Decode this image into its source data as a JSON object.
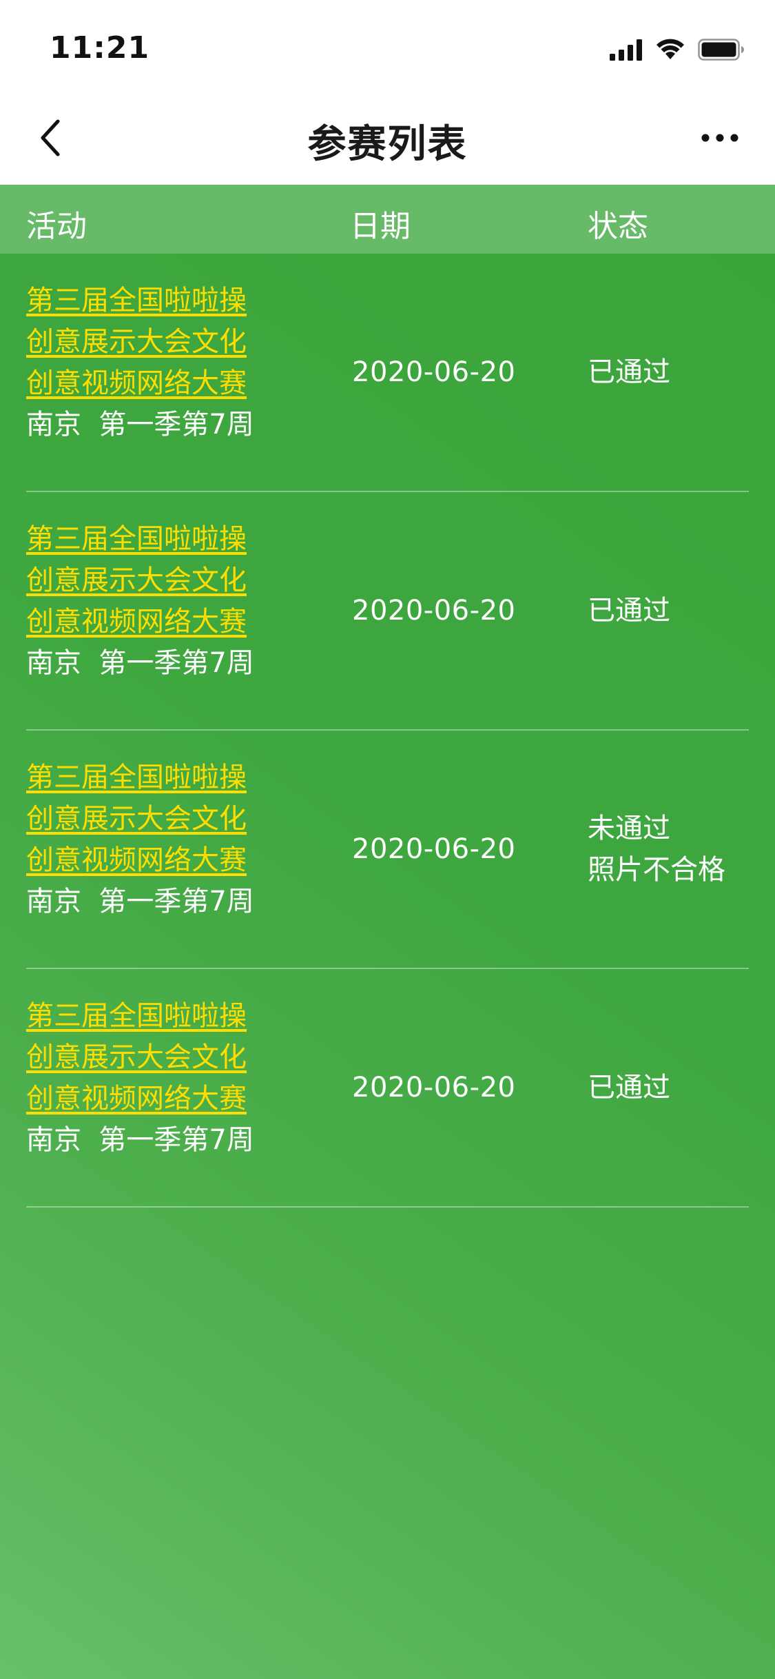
{
  "status_bar": {
    "time": "11:21",
    "icons": [
      "signal-icon",
      "wifi-icon",
      "battery-icon"
    ]
  },
  "nav": {
    "title": "参赛列表",
    "back_icon": "chevron-left-icon",
    "more_icon": "more-icon"
  },
  "table": {
    "headers": {
      "activity": "活动",
      "date": "日期",
      "status": "状态"
    },
    "rows": [
      {
        "activity_title": "第三届全国啦啦操\n创意展示大会文化\n创意视频网络大赛",
        "activity_meta": "南京  第一季第7周",
        "date": "2020-06-20",
        "status": "已通过",
        "status_reason": ""
      },
      {
        "activity_title": "第三届全国啦啦操\n创意展示大会文化\n创意视频网络大赛",
        "activity_meta": "南京  第一季第7周",
        "date": "2020-06-20",
        "status": "已通过",
        "status_reason": ""
      },
      {
        "activity_title": "第三届全国啦啦操\n创意展示大会文化\n创意视频网络大赛",
        "activity_meta": "南京  第一季第7周",
        "date": "2020-06-20",
        "status": "未通过",
        "status_reason": "照片不合格"
      },
      {
        "activity_title": "第三届全国啦啦操\n创意展示大会文化\n创意视频网络大赛",
        "activity_meta": "南京  第一季第7周",
        "date": "2020-06-20",
        "status": "已通过",
        "status_reason": ""
      }
    ]
  },
  "colors": {
    "background_green": "#3fa740",
    "header_green": "#67ba68",
    "link_yellow": "#ffdd00",
    "text_white": "#ffffff"
  }
}
